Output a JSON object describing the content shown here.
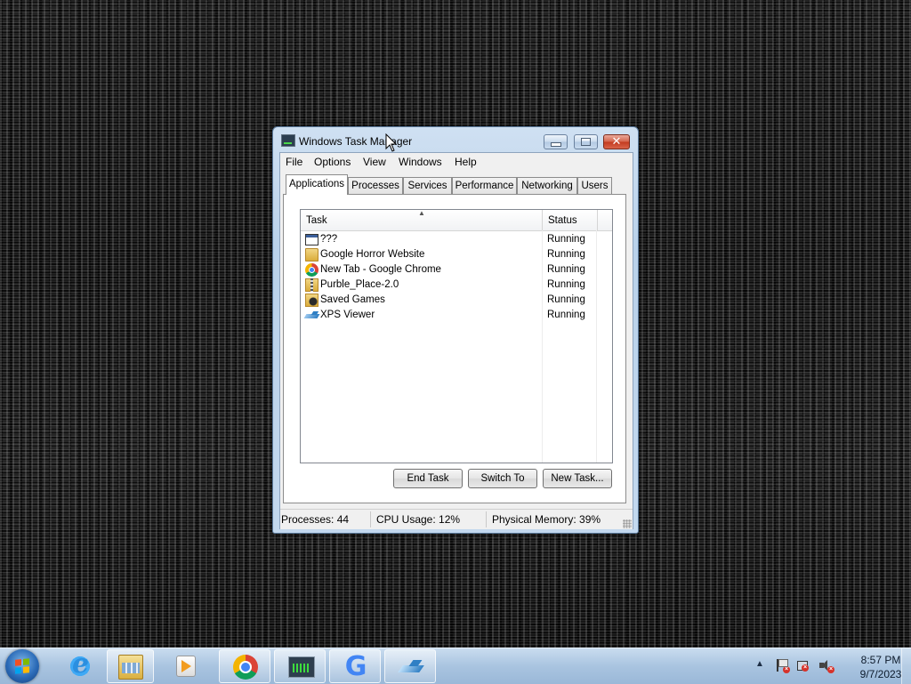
{
  "window": {
    "title": "Windows Task Manager",
    "menu": [
      "File",
      "Options",
      "View",
      "Windows",
      "Help"
    ]
  },
  "tabs": [
    {
      "label": "Applications",
      "active": true
    },
    {
      "label": "Processes",
      "active": false
    },
    {
      "label": "Services",
      "active": false
    },
    {
      "label": "Performance",
      "active": false
    },
    {
      "label": "Networking",
      "active": false
    },
    {
      "label": "Users",
      "active": false
    }
  ],
  "task_list": {
    "columns": [
      "Task",
      "Status"
    ],
    "rows": [
      {
        "name": "???",
        "status": "Running",
        "icon": "window-icon"
      },
      {
        "name": "Google Horror Website",
        "status": "Running",
        "icon": "folder-icon"
      },
      {
        "name": "New Tab - Google Chrome",
        "status": "Running",
        "icon": "chrome-icon"
      },
      {
        "name": "Purble_Place-2.0",
        "status": "Running",
        "icon": "zip-folder-icon"
      },
      {
        "name": "Saved Games",
        "status": "Running",
        "icon": "saved-games-icon"
      },
      {
        "name": "XPS Viewer",
        "status": "Running",
        "icon": "xps-viewer-icon"
      }
    ]
  },
  "buttons": {
    "end_task": "End Task",
    "switch_to": "Switch To",
    "new_task": "New Task..."
  },
  "statusbar": {
    "processes": "Processes: 44",
    "cpu": "CPU Usage: 12%",
    "memory": "Physical Memory: 39%"
  },
  "taskbar": {
    "pinned": [
      "internet-explorer-icon",
      "windows-explorer-icon",
      "media-player-icon",
      "chrome-icon",
      "task-manager-icon",
      "google-icon",
      "xps-viewer-icon"
    ],
    "clock_time": "8:57 PM",
    "clock_date": "9/7/2023"
  }
}
